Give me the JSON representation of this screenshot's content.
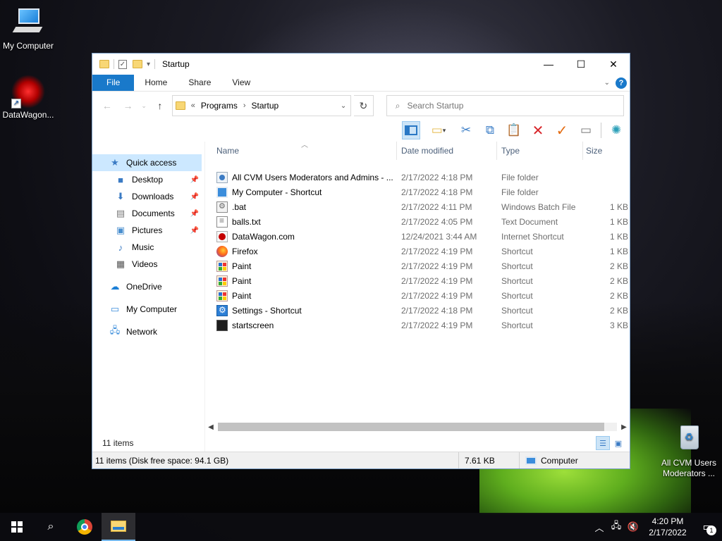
{
  "desktop": {
    "icons": [
      {
        "label": "My Computer"
      },
      {
        "label": "DataWagon..."
      },
      {
        "label": "All CVM Users Moderators ..."
      }
    ]
  },
  "window": {
    "title": "Startup",
    "controls": {
      "minimize": "—",
      "maximize": "☐",
      "close": "✕"
    },
    "ribbon": {
      "tabs": [
        "File",
        "Home",
        "Share",
        "View"
      ]
    },
    "address": {
      "overflow": "«",
      "crumbs": [
        "Programs",
        "Startup"
      ]
    },
    "search": {
      "placeholder": "Search Startup"
    },
    "columns": {
      "name": "Name",
      "date": "Date modified",
      "type": "Type",
      "size": "Size"
    },
    "nav": {
      "quick_access": "Quick access",
      "items": [
        "Desktop",
        "Downloads",
        "Documents",
        "Pictures",
        "Music",
        "Videos"
      ],
      "onedrive": "OneDrive",
      "mycomputer": "My Computer",
      "network": "Network"
    },
    "files": [
      {
        "name": "All CVM Users Moderators and Admins - ...",
        "date": "2/17/2022 4:18 PM",
        "type": "File folder",
        "size": "",
        "icon": "folder-icon"
      },
      {
        "name": "My Computer - Shortcut",
        "date": "2/17/2022 4:18 PM",
        "type": "File folder",
        "size": "",
        "icon": "computer-icon"
      },
      {
        "name": ".bat",
        "date": "2/17/2022 4:11 PM",
        "type": "Windows Batch File",
        "size": "1 KB",
        "icon": "batch-file-icon"
      },
      {
        "name": "balls.txt",
        "date": "2/17/2022 4:05 PM",
        "type": "Text Document",
        "size": "1 KB",
        "icon": "text-file-icon"
      },
      {
        "name": "DataWagon.com",
        "date": "12/24/2021 3:44 AM",
        "type": "Internet Shortcut",
        "size": "1 KB",
        "icon": "internet-shortcut-icon"
      },
      {
        "name": "Firefox",
        "date": "2/17/2022 4:19 PM",
        "type": "Shortcut",
        "size": "1 KB",
        "icon": "firefox-icon"
      },
      {
        "name": "Paint",
        "date": "2/17/2022 4:19 PM",
        "type": "Shortcut",
        "size": "2 KB",
        "icon": "paint-icon"
      },
      {
        "name": "Paint",
        "date": "2/17/2022 4:19 PM",
        "type": "Shortcut",
        "size": "2 KB",
        "icon": "paint-icon"
      },
      {
        "name": "Paint",
        "date": "2/17/2022 4:19 PM",
        "type": "Shortcut",
        "size": "2 KB",
        "icon": "paint-icon"
      },
      {
        "name": "Settings - Shortcut",
        "date": "2/17/2022 4:18 PM",
        "type": "Shortcut",
        "size": "2 KB",
        "icon": "settings-icon"
      },
      {
        "name": "startscreen",
        "date": "2/17/2022 4:19 PM",
        "type": "Shortcut",
        "size": "3 KB",
        "icon": "startscreen-icon"
      }
    ],
    "item_count": "11 items",
    "status": {
      "summary": "11 items (Disk free space: 94.1 GB)",
      "size": "7.61 KB",
      "location": "Computer"
    }
  },
  "taskbar": {
    "time": "4:20 PM",
    "date": "2/17/2022",
    "notification_count": "1"
  }
}
